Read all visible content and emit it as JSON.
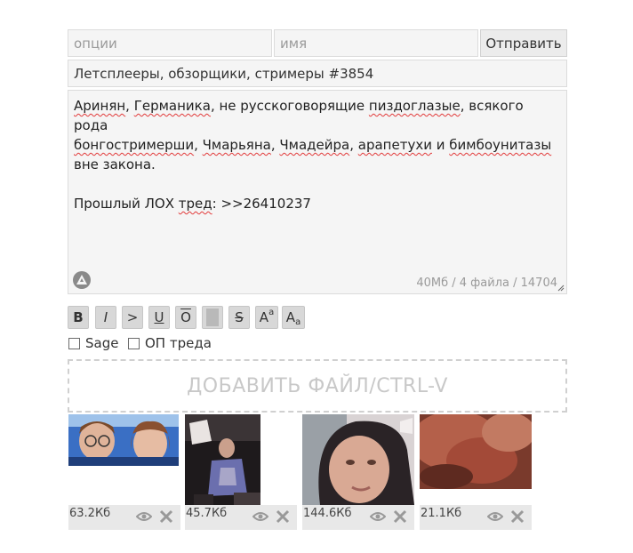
{
  "form": {
    "options_placeholder": "опции",
    "name_placeholder": "имя",
    "send_label": "Отправить",
    "subject": "Летсплееры, обзорщики, стримеры #3854",
    "comment": {
      "line1_a": "Аринян",
      "line1_b": ", ",
      "line1_c": "Германика",
      "line1_d": ", не русскоговорящие ",
      "line1_e": "пиздоглазые",
      "line1_f": ", всякого рода",
      "line2_a": "бонгостримерши",
      "line2_b": ", ",
      "line2_c": "Чмарьяна",
      "line2_d": ", ",
      "line2_e": "Чмадейра",
      "line2_f": ", ",
      "line2_g": "арапетухи",
      "line2_h": " и ",
      "line2_i": "бимбоунитазы",
      "line3": "вне закона.",
      "line4_a": "Прошлый ЛОХ ",
      "line4_b": "тред",
      "line4_c": ": >>26410237"
    },
    "counter": "40Мб / 4 файла / 14704"
  },
  "markup_buttons": {
    "bold": "B",
    "italic": "I",
    "quote": ">",
    "underline": "U",
    "overline": "O",
    "spoiler": "",
    "strike": "S",
    "sup_a": "A",
    "sup_b": "a",
    "sub_a": "A",
    "sub_b": "a"
  },
  "checkboxes": {
    "sage": "Sage",
    "op": "ОП треда"
  },
  "dropzone_label": "ДОБАВИТЬ ФАЙЛ/CTRL-V",
  "attachments": [
    {
      "size": "63.2Кб",
      "view_icon": "eye-icon",
      "remove_icon": "close-icon"
    },
    {
      "size": "45.7Кб",
      "view_icon": "eye-icon",
      "remove_icon": "close-icon"
    },
    {
      "size": "144.6Кб",
      "view_icon": "eye-icon",
      "remove_icon": "close-icon"
    },
    {
      "size": "21.1Кб",
      "view_icon": "eye-icon",
      "remove_icon": "close-icon"
    }
  ],
  "colors": {
    "accent": "#f06522",
    "spellcheck": "#e23a3a"
  }
}
